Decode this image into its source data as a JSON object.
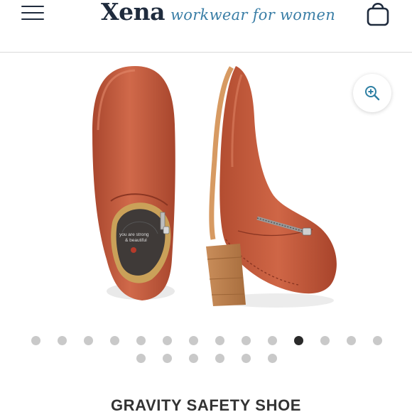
{
  "header": {
    "brand_name": "Xena",
    "brand_tagline": "workwear for women"
  },
  "product": {
    "title": "GRAVITY SAFETY SHOE",
    "insole_text_line1": "you are strong",
    "insole_text_line2": "& beautiful"
  },
  "gallery": {
    "dot_count": 20,
    "active_index": 10
  },
  "colors": {
    "leather": "#c0573a",
    "heel": "#b97a4a",
    "navy": "#1f2b3d",
    "accent_blue": "#3a7ea6",
    "zoom_icon": "#2d7fa3",
    "dot_inactive": "#c9c9c9",
    "dot_active": "#2a2a2a"
  }
}
